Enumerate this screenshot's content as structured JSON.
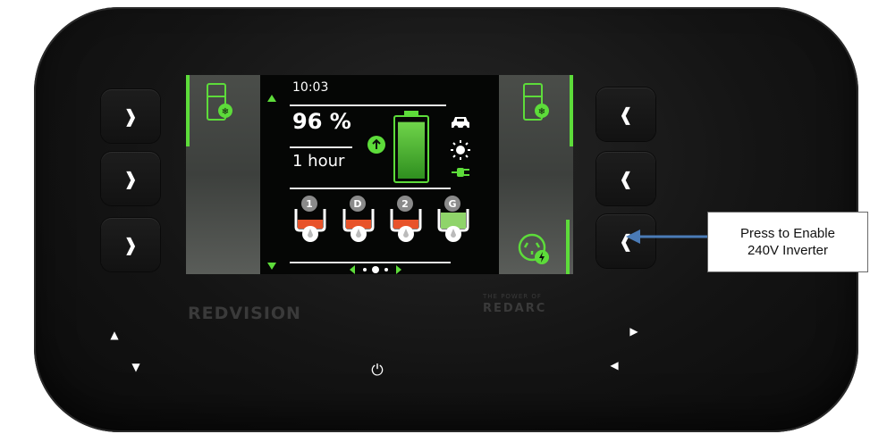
{
  "device": {
    "brand_left": "REDVISION",
    "brand_right_small": "THE POWER OF",
    "brand_right_big": "REDARC"
  },
  "buttons": {
    "left_chevron": "❱",
    "right_chevron": "❰",
    "up_arrow": "▲",
    "down_arrow": "▼",
    "right_arrow": "▶",
    "left_arrow": "◀",
    "power": "⏻"
  },
  "screen": {
    "time": "10:03",
    "battery_percent": "96 %",
    "time_remaining": "1 hour",
    "battery_level": 0.96,
    "tanks": [
      {
        "label": "1",
        "level": 0.3
      },
      {
        "label": "D",
        "level": 0.3
      },
      {
        "label": "2",
        "level": 0.3
      },
      {
        "label": "G",
        "level": 0.7
      }
    ],
    "page_count": 3,
    "current_page": 2
  },
  "callout": {
    "line1": "Press to Enable",
    "line2": "240V Inverter"
  },
  "colors": {
    "accent_green": "#5ddc3a",
    "tank_red": "#e8532a",
    "grey_water_green": "#8fd46a",
    "arrow_blue": "#4a7bb7"
  }
}
